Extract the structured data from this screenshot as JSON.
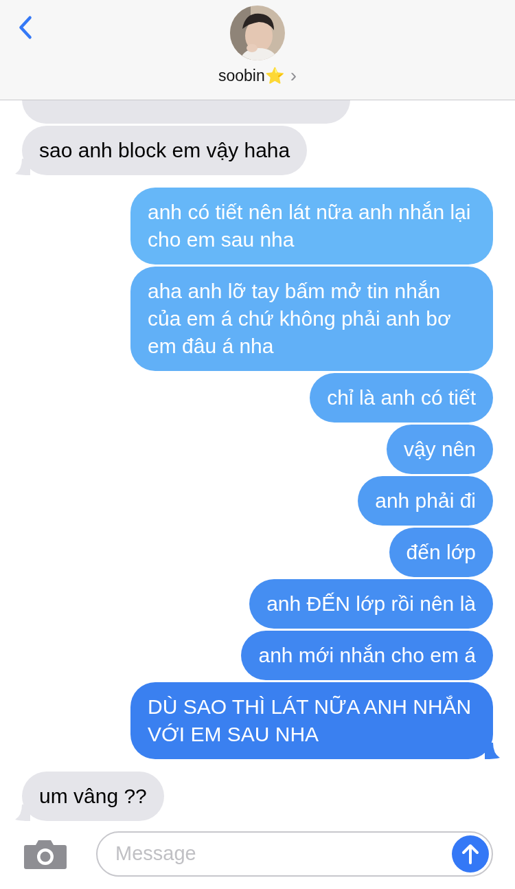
{
  "header": {
    "name": "soobin⭐️",
    "chevron": "›"
  },
  "messages": [
    {
      "outgoing": false,
      "kind": "cut"
    },
    {
      "outgoing": false,
      "kind": "text",
      "text": "sao anh block em vậy haha",
      "tail": true
    },
    {
      "outgoing": true,
      "kind": "text",
      "text": "anh có tiết nên lát nữa anh nhắn lại cho em sau nha",
      "tail": false
    },
    {
      "outgoing": true,
      "kind": "text",
      "text": "aha anh lỡ tay bấm mở tin nhắn của em á chứ không phải anh bơ em đâu á nha",
      "tail": false
    },
    {
      "outgoing": true,
      "kind": "text",
      "text": "chỉ là anh có tiết",
      "tail": false
    },
    {
      "outgoing": true,
      "kind": "text",
      "text": "vậy nên",
      "tail": false
    },
    {
      "outgoing": true,
      "kind": "text",
      "text": "anh phải đi",
      "tail": false
    },
    {
      "outgoing": true,
      "kind": "text",
      "text": "đến lớp",
      "tail": false
    },
    {
      "outgoing": true,
      "kind": "text",
      "text": "anh ĐẾN lớp rồi nên là",
      "tail": false
    },
    {
      "outgoing": true,
      "kind": "text",
      "text": "anh mới nhắn cho em á",
      "tail": false
    },
    {
      "outgoing": true,
      "kind": "text",
      "text": "DÙ SAO THÌ LÁT NỮA ANH NHẮN VỚI EM SAU NHA",
      "tail": true
    },
    {
      "outgoing": false,
      "kind": "text",
      "text": "um vâng ??",
      "tail": true
    }
  ],
  "composer": {
    "placeholder": "Message"
  }
}
